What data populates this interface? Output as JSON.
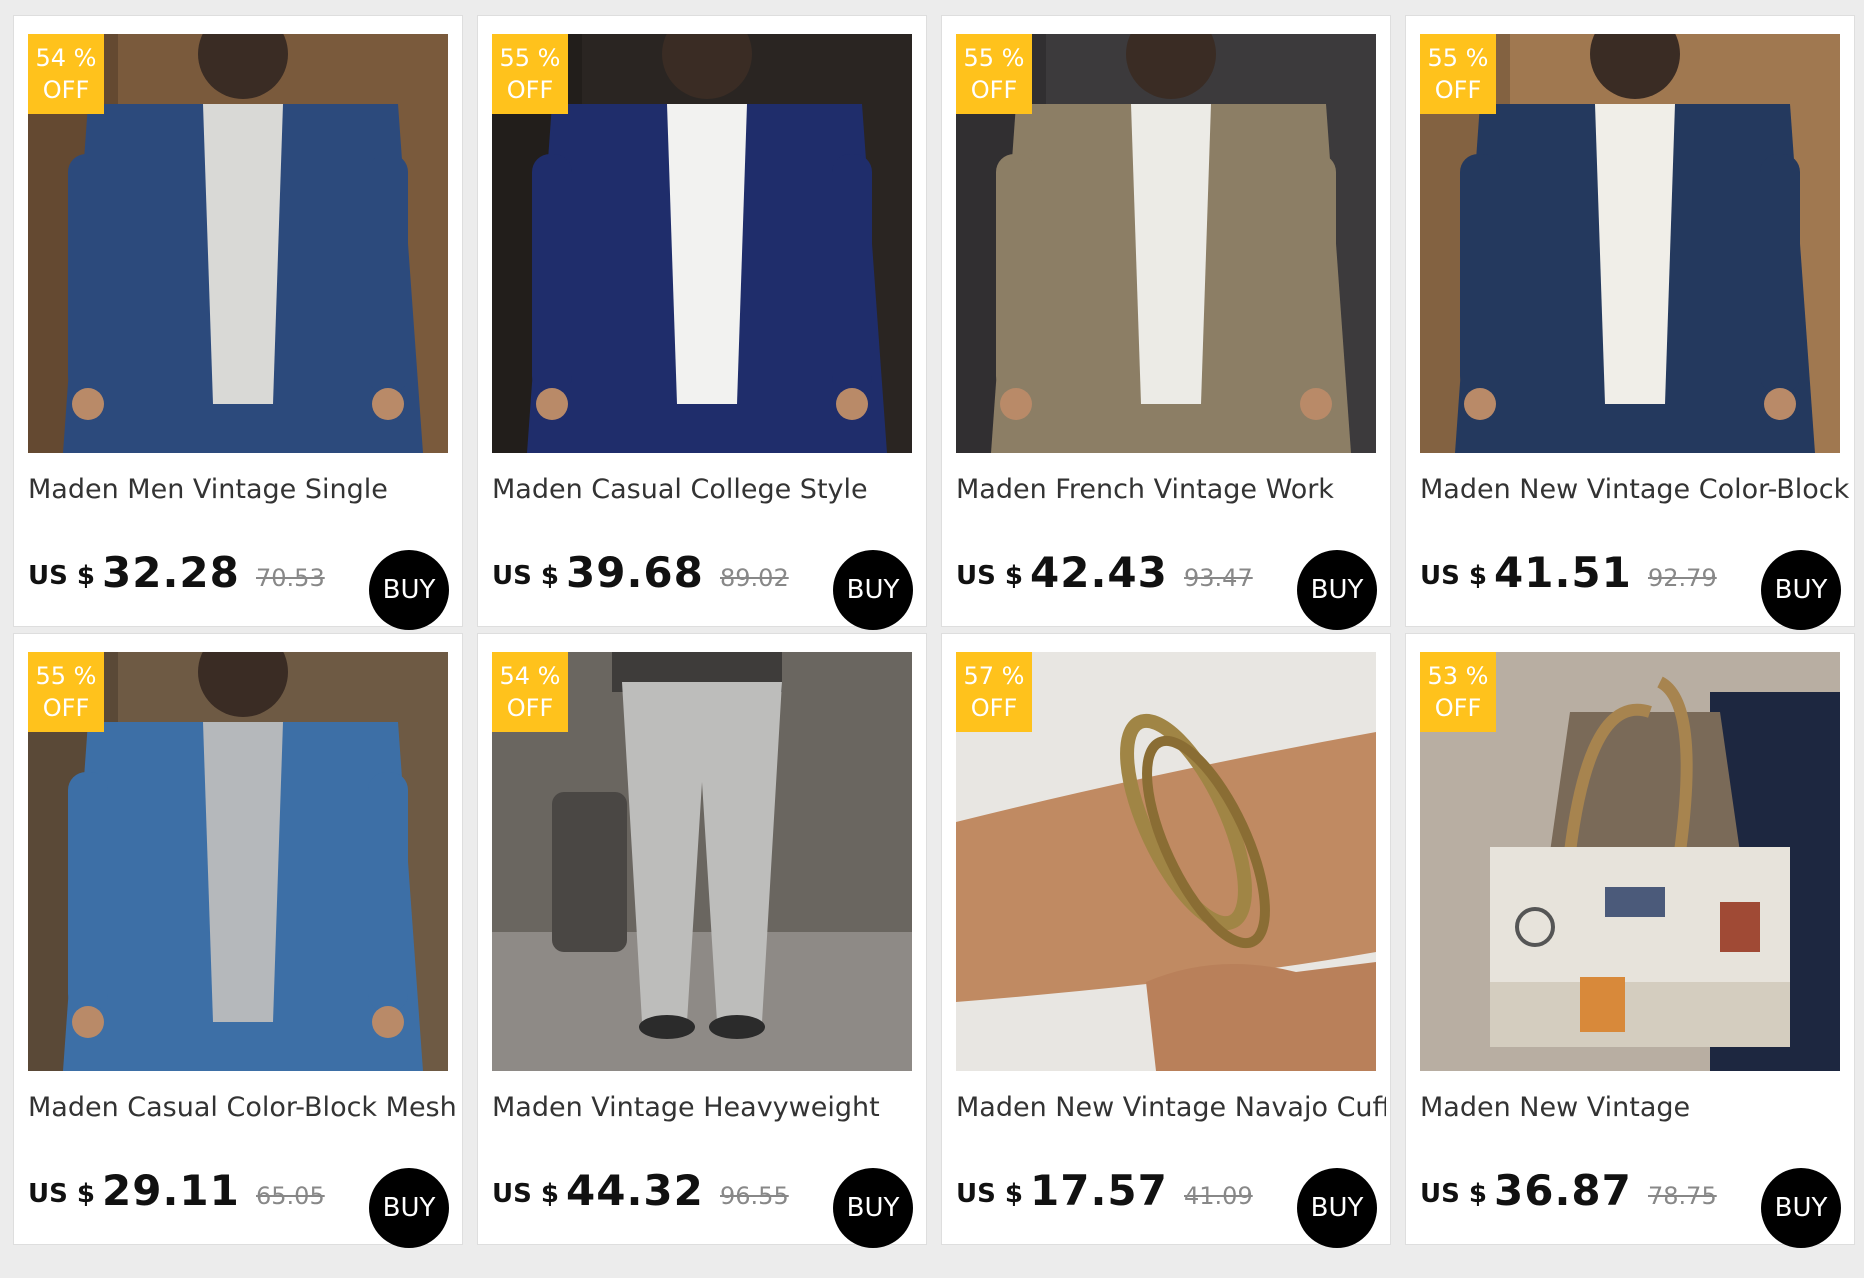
{
  "currency_label": "US $",
  "buy_label": "BUY",
  "off_label": "OFF",
  "products": [
    {
      "discount": "54 %",
      "title": "Maden Men Vintage Single",
      "price": "32.28",
      "old_price": "70.53",
      "image": "denim-shirt-photo",
      "colors": {
        "bg": "#7a5a3c",
        "main": "#2c4a7c",
        "inner": "#d9d9d6"
      }
    },
    {
      "discount": "55 %",
      "title": "Maden Casual College Style",
      "price": "39.68",
      "old_price": "89.02",
      "image": "college-jacket-photo",
      "colors": {
        "bg": "#2a2522",
        "main": "#1f2d6b",
        "inner": "#f2f2f0"
      }
    },
    {
      "discount": "55 %",
      "title": "Maden French Vintage Work",
      "price": "42.43",
      "old_price": "93.47",
      "image": "work-jacket-photo",
      "colors": {
        "bg": "#3c3a3c",
        "main": "#8c7e65",
        "inner": "#ecebe6"
      }
    },
    {
      "discount": "55 %",
      "title": "Maden New Vintage Color-Block",
      "price": "41.51",
      "old_price": "92.79",
      "image": "pullover-photo",
      "colors": {
        "bg": "#a07850",
        "main": "#24395e",
        "inner": "#f0eee8"
      }
    },
    {
      "discount": "55 %",
      "title": "Maden Casual Color-Block Mesh",
      "price": "29.11",
      "old_price": "65.05",
      "image": "raglan-tee-photo",
      "colors": {
        "bg": "#6e5a44",
        "main": "#3d6fa6",
        "inner": "#b5b8bb"
      }
    },
    {
      "discount": "54 %",
      "title": "Maden Vintage Heavyweight",
      "price": "44.32",
      "old_price": "96.55",
      "image": "grey-jeans-photo",
      "colors": {
        "bg": "#6a6660",
        "main": "#bdbdbb",
        "inner": "#3e3c3a"
      }
    },
    {
      "discount": "57 %",
      "title": "Maden New Vintage Navajo Cuff",
      "price": "17.57",
      "old_price": "41.09",
      "image": "cuff-bracelet-photo",
      "colors": {
        "bg": "#e8e6e2",
        "main": "#c08a62",
        "inner": "#a08545"
      }
    },
    {
      "discount": "53 %",
      "title": "Maden New Vintage",
      "price": "36.87",
      "old_price": "78.75",
      "image": "canvas-tote-photo",
      "colors": {
        "bg": "#b8aea2",
        "main": "#e7e3db",
        "inner": "#a7844f"
      }
    }
  ]
}
